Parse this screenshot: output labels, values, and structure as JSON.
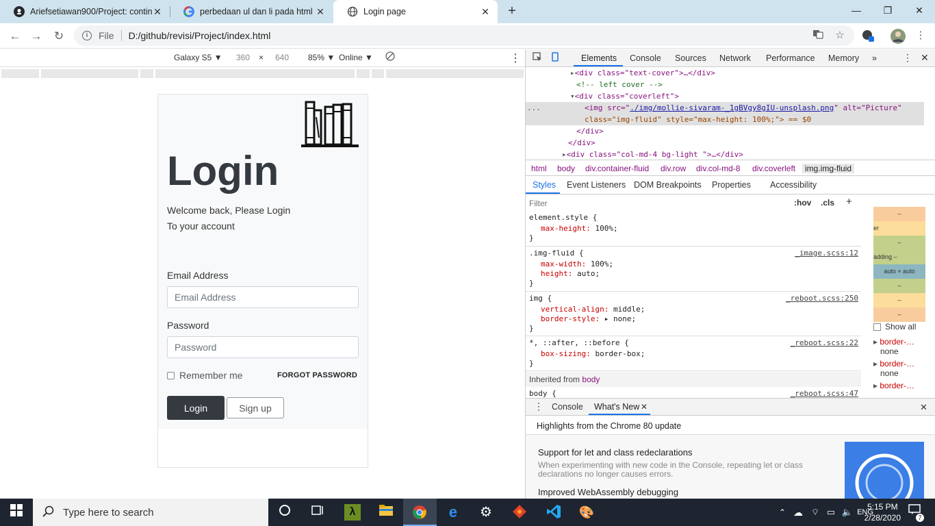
{
  "browser": {
    "tabs": [
      {
        "title": "Ariefsetiawan900/Project: contin",
        "icon": "github-icon"
      },
      {
        "title": "perbedaan ul dan li pada html - G",
        "icon": "google-icon"
      },
      {
        "title": "Login page",
        "icon": "globe-icon"
      }
    ],
    "url_scheme": "File",
    "url": "D:/github/revisi/Project/index.html"
  },
  "device_toolbar": {
    "device": "Galaxy S5 ▼",
    "width": "360",
    "times": "×",
    "height": "640",
    "zoom": "85% ▼",
    "network": "Online ▼"
  },
  "page": {
    "title": "Login",
    "welcome_line1": "Welcome back, Please Login",
    "welcome_line2": "To your account",
    "email_label": "Email Address",
    "email_placeholder": "Email Address",
    "password_label": "Password",
    "password_placeholder": "Password",
    "remember_label": "Remember me",
    "forgot_label": "FORGOT PASSWORD",
    "login_button": "Login",
    "signup_button": "Sign up"
  },
  "devtools": {
    "tabs": [
      "Elements",
      "Console",
      "Sources",
      "Network",
      "Performance",
      "Memory",
      "»"
    ],
    "dom": {
      "l1_tag": "<div class=\"text-cover\">…</div>",
      "l2_comment": "<!-- left cover -->",
      "l3_tag": "<div class=\"coverleft\">",
      "l4_a": "<img src=\"",
      "l4_src": "./img/mollie-sivaram-_1gBVgy8gIU-unsplash.png",
      "l4_b": "\" alt=\"Picture\"",
      "l5": "class=\"img-fluid\" style=\"max-height: 100%;\"> == $0",
      "l6": "</div>",
      "l7": "</div>",
      "l8": "<div class=\"col-md-4 bg-light \">…</div>",
      "ellipsis": "..."
    },
    "breadcrumb": [
      "html",
      "body",
      "div.container-fluid",
      "div.row",
      "div.col-md-8",
      "div.coverleft",
      "img.img-fluid"
    ],
    "subtabs": [
      "Styles",
      "Event Listeners",
      "DOM Breakpoints",
      "Properties",
      "Accessibility"
    ],
    "filter_placeholder": "Filter",
    "hov": ":hov",
    "cls": ".cls",
    "plus": "+",
    "rules": [
      {
        "selector": "element.style {",
        "source": "",
        "props": [
          [
            "max-height",
            "100%;"
          ]
        ]
      },
      {
        "selector": ".img-fluid {",
        "source": "_image.scss:12",
        "props": [
          [
            "max-width",
            "100%;"
          ],
          [
            "height",
            "auto;"
          ]
        ]
      },
      {
        "selector": "img {",
        "source": "_reboot.scss:250",
        "props": [
          [
            "vertical-align",
            "middle;"
          ],
          [
            "border-style",
            "▸ none;"
          ]
        ]
      },
      {
        "selector": "*, ::after, ::before {",
        "source": "_reboot.scss:22",
        "props": [
          [
            "box-sizing",
            "border-box;"
          ]
        ]
      }
    ],
    "inherited_label": "Inherited from",
    "inherited_tag": "body",
    "body_rule": "body {",
    "body_source": "_reboot.scss:47",
    "boxmodel": [
      "–",
      "er",
      "–",
      "adding –",
      "auto × auto",
      "–",
      "–",
      "–"
    ],
    "show_all": "Show all",
    "computed": [
      {
        "name": "border-…",
        "value": "none"
      },
      {
        "name": "border-…",
        "value": "none"
      },
      {
        "name": "border-…",
        "value": ""
      }
    ],
    "drawer_tabs": [
      "Console",
      "What's New"
    ],
    "whats_new_header": "Highlights from the Chrome 80 update",
    "whats_new_item1_title": "Support for let and class redeclarations",
    "whats_new_item1_desc": "When experimenting with new code in the Console, repeating let or class declarations no longer causes errors.",
    "whats_new_item2_title": "Improved WebAssembly debugging"
  },
  "taskbar": {
    "search_placeholder": "Type here to search",
    "time": "5:15 PM",
    "date": "2/28/2020",
    "notifications": "7"
  },
  "colors": {
    "tabstrip": "#cfe3ee",
    "brand_dark": "#343a40",
    "devtools_blue": "#1a73e8",
    "taskbar": "#1e2530"
  }
}
